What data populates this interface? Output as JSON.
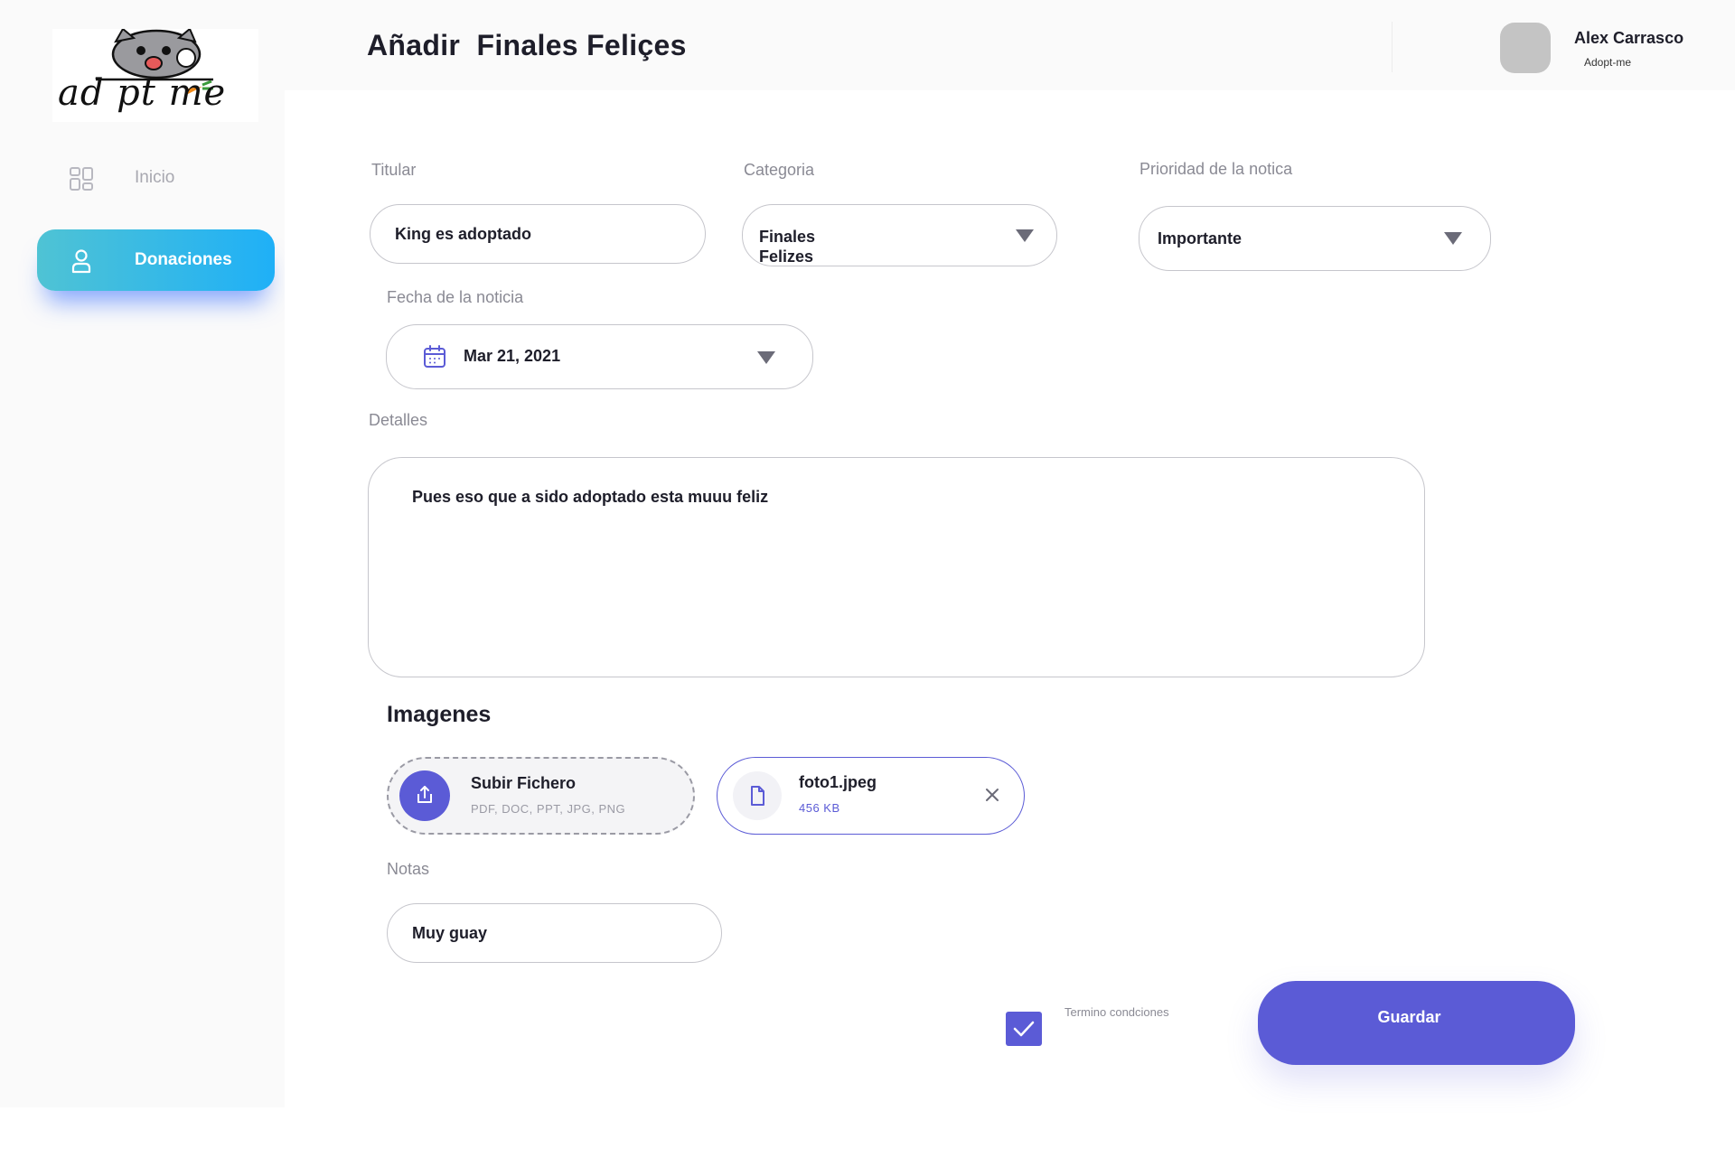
{
  "brand": {
    "logo_text": "ad pt me"
  },
  "sidebar": {
    "items": [
      {
        "label": "Inicio",
        "icon": "dashboard-icon",
        "active": false
      },
      {
        "label": "Donaciones",
        "icon": "user-icon",
        "active": true
      }
    ],
    "active_gradient": [
      "#4fc3d4",
      "#1fb0f7"
    ]
  },
  "header": {
    "title": "Añadir  Finales Feliçes",
    "user": {
      "name": "Alex Carrasco",
      "subtitle": "Adopt-me",
      "avatar_icon": "avatar-placeholder"
    }
  },
  "form": {
    "titular": {
      "label": "Titular",
      "value": "King es adoptado"
    },
    "categoria": {
      "label": "Categoria",
      "value": "Finales Felizes"
    },
    "prioridad": {
      "label": "Prioridad de la notica",
      "value": "Importante"
    },
    "fecha": {
      "label": "Fecha de la noticia",
      "value": "Mar 21, 2021",
      "icon": "calendar-icon"
    },
    "detalles": {
      "label": "Detalles",
      "value": "Pues eso que a sido adoptado esta muuu feliz"
    },
    "imagenes": {
      "title": "Imagenes",
      "upload": {
        "title": "Subir Fichero",
        "formats": "PDF, DOC, PPT, JPG, PNG",
        "icon": "upload-icon"
      },
      "files": [
        {
          "name": "foto1.jpeg",
          "size": "456 KB",
          "icon": "file-icon"
        }
      ]
    },
    "notas": {
      "label": "Notas",
      "value": "Muy guay"
    },
    "terms": {
      "label": "Termino condciones",
      "checked": true
    },
    "save_label": "Guardar"
  },
  "colors": {
    "accent": "#5b5bd6",
    "text": "#1e1e2a",
    "muted": "#8a8a94",
    "border": "#c6c6cc"
  }
}
